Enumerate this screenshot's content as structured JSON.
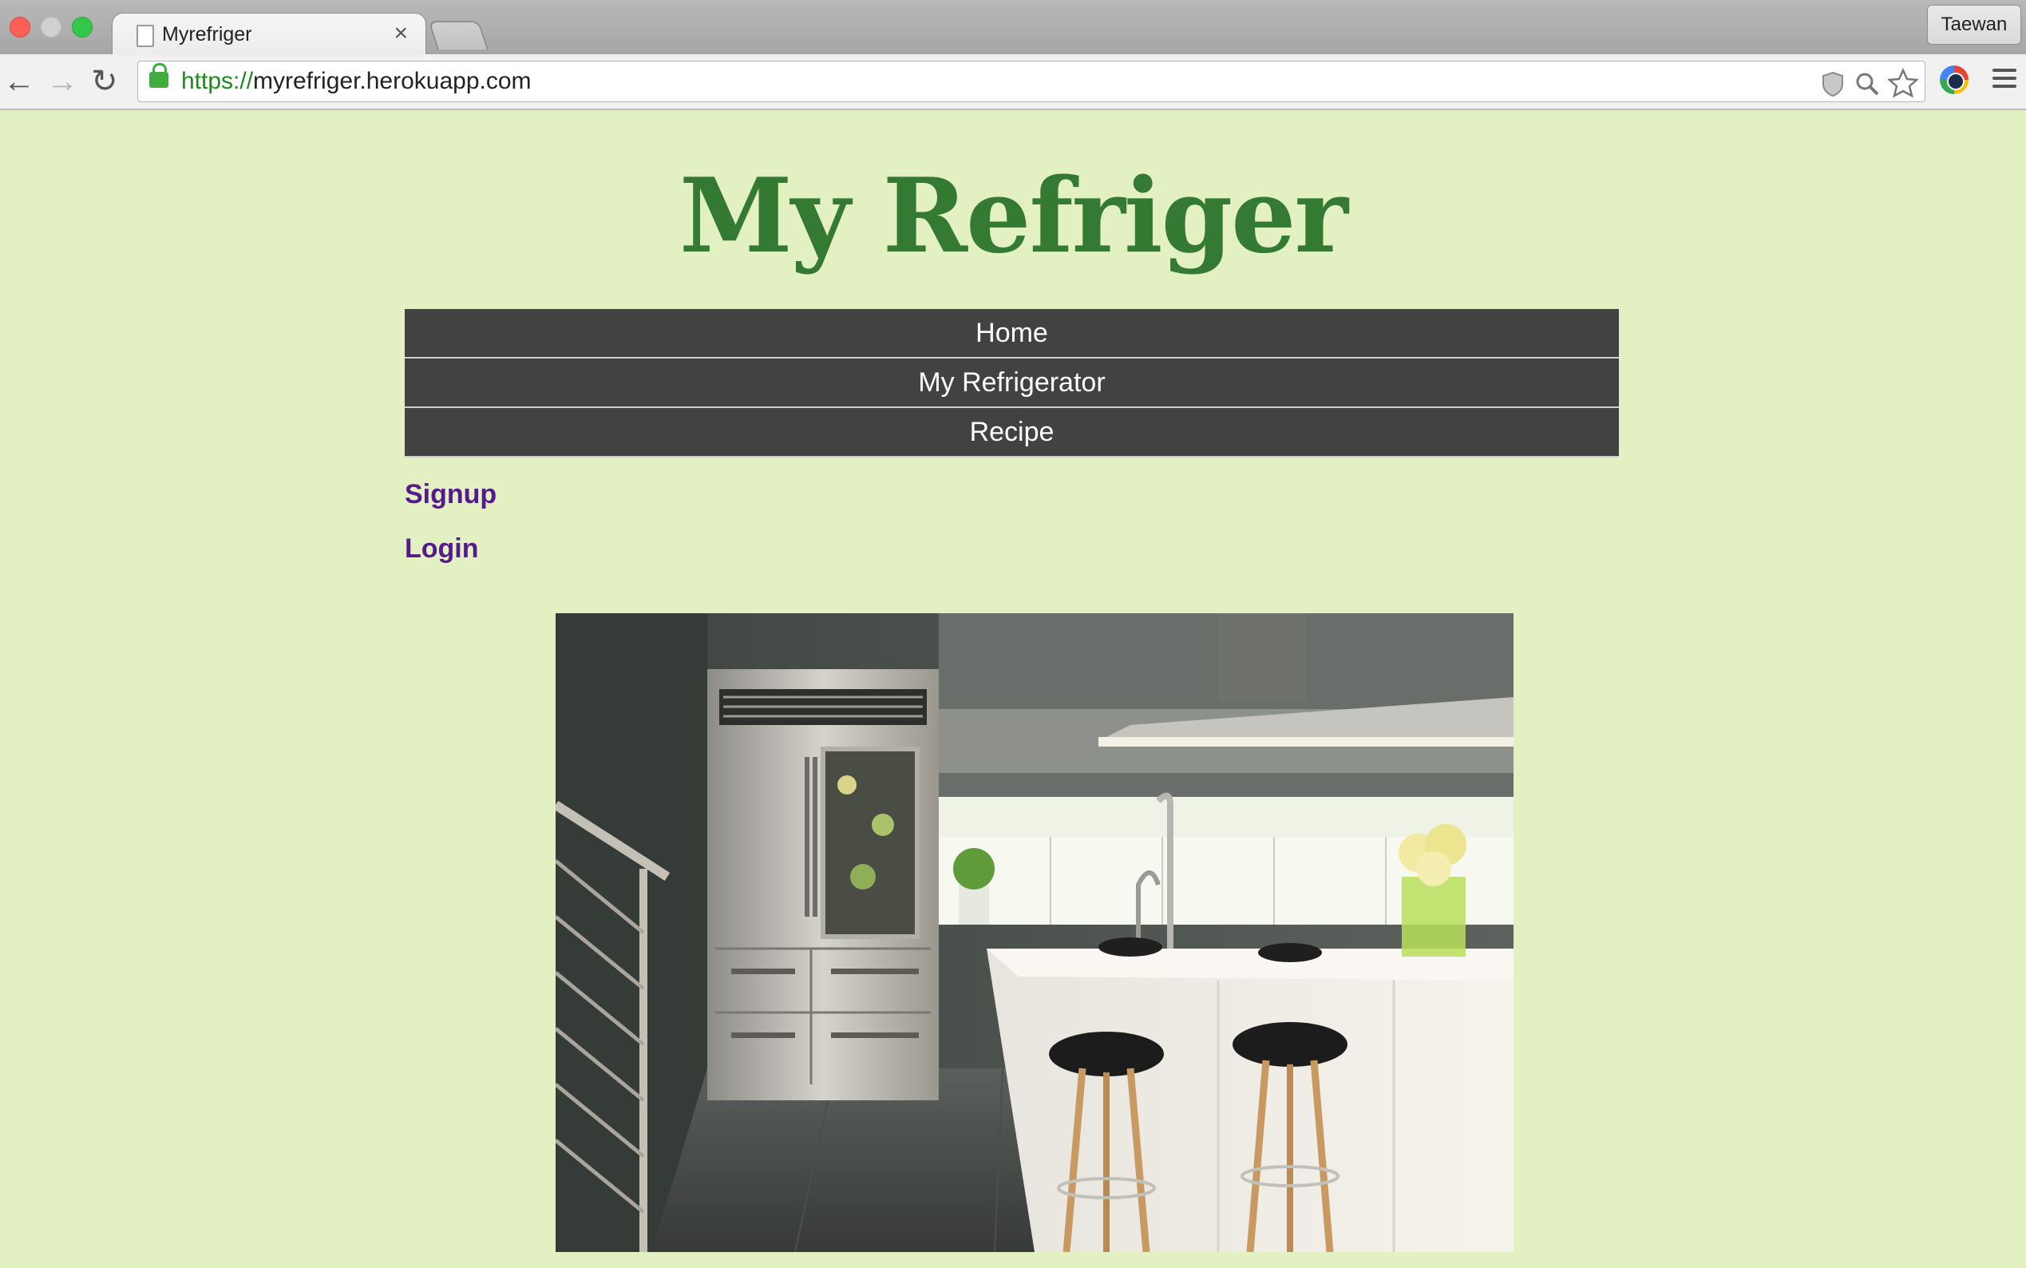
{
  "browser": {
    "tab_title": "Myrefriger",
    "tab_close": "×",
    "profile_name": "Taewan",
    "url_scheme": "https://",
    "url_rest": "myrefriger.herokuapp.com",
    "icons": [
      "back-arrow-icon",
      "forward-arrow-icon",
      "reload-icon",
      "lock-icon",
      "shield-icon",
      "zoom-icon",
      "star-icon",
      "extension-icon",
      "menu-icon"
    ]
  },
  "page": {
    "title": "My Refriger",
    "nav": [
      {
        "label": "Home"
      },
      {
        "label": "My Refrigerator"
      },
      {
        "label": "Recipe"
      }
    ],
    "links": {
      "signup": "Signup",
      "login": "Login"
    },
    "colors": {
      "background": "#e3f0c2",
      "title": "#347a33",
      "nav_bg": "#424242",
      "link": "#551a8b"
    }
  }
}
